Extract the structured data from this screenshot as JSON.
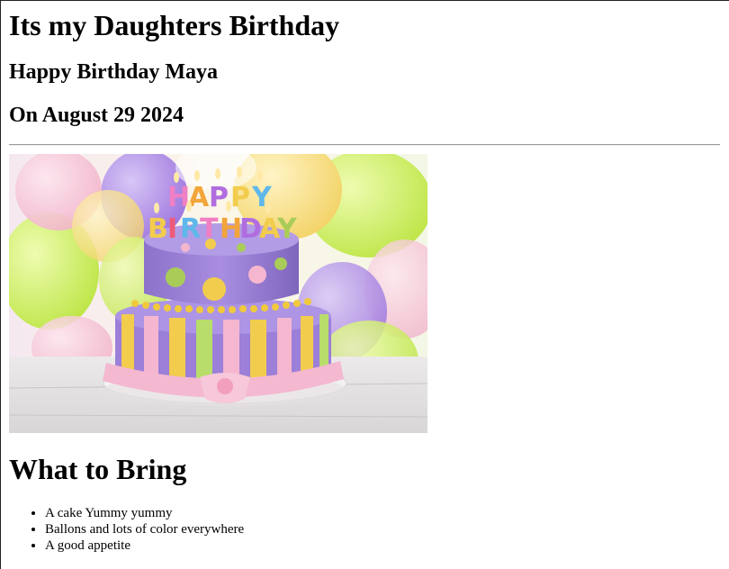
{
  "page": {
    "title": "Its my Daughters Birthday",
    "subtitle": "Happy Birthday Maya",
    "date_line": "On August 29 2024"
  },
  "image": {
    "depicts": "birthday-cake-photo",
    "candles_letters": [
      "H",
      "A",
      "P",
      "P",
      "Y",
      "B",
      "I",
      "R",
      "T",
      "H",
      "D",
      "A",
      "Y"
    ],
    "colors": {
      "balloon_green": "#c9f25a",
      "balloon_purple": "#a97fe0",
      "cake_purple": "#9a7fd6",
      "ribbon_pink": "#f4b8d0",
      "stripe_yellow": "#f2cc4d"
    }
  },
  "bring": {
    "heading": "What to Bring",
    "items": [
      "A cake Yummy yummy",
      "Ballons and lots of color everywhere",
      "A good appetite"
    ]
  }
}
